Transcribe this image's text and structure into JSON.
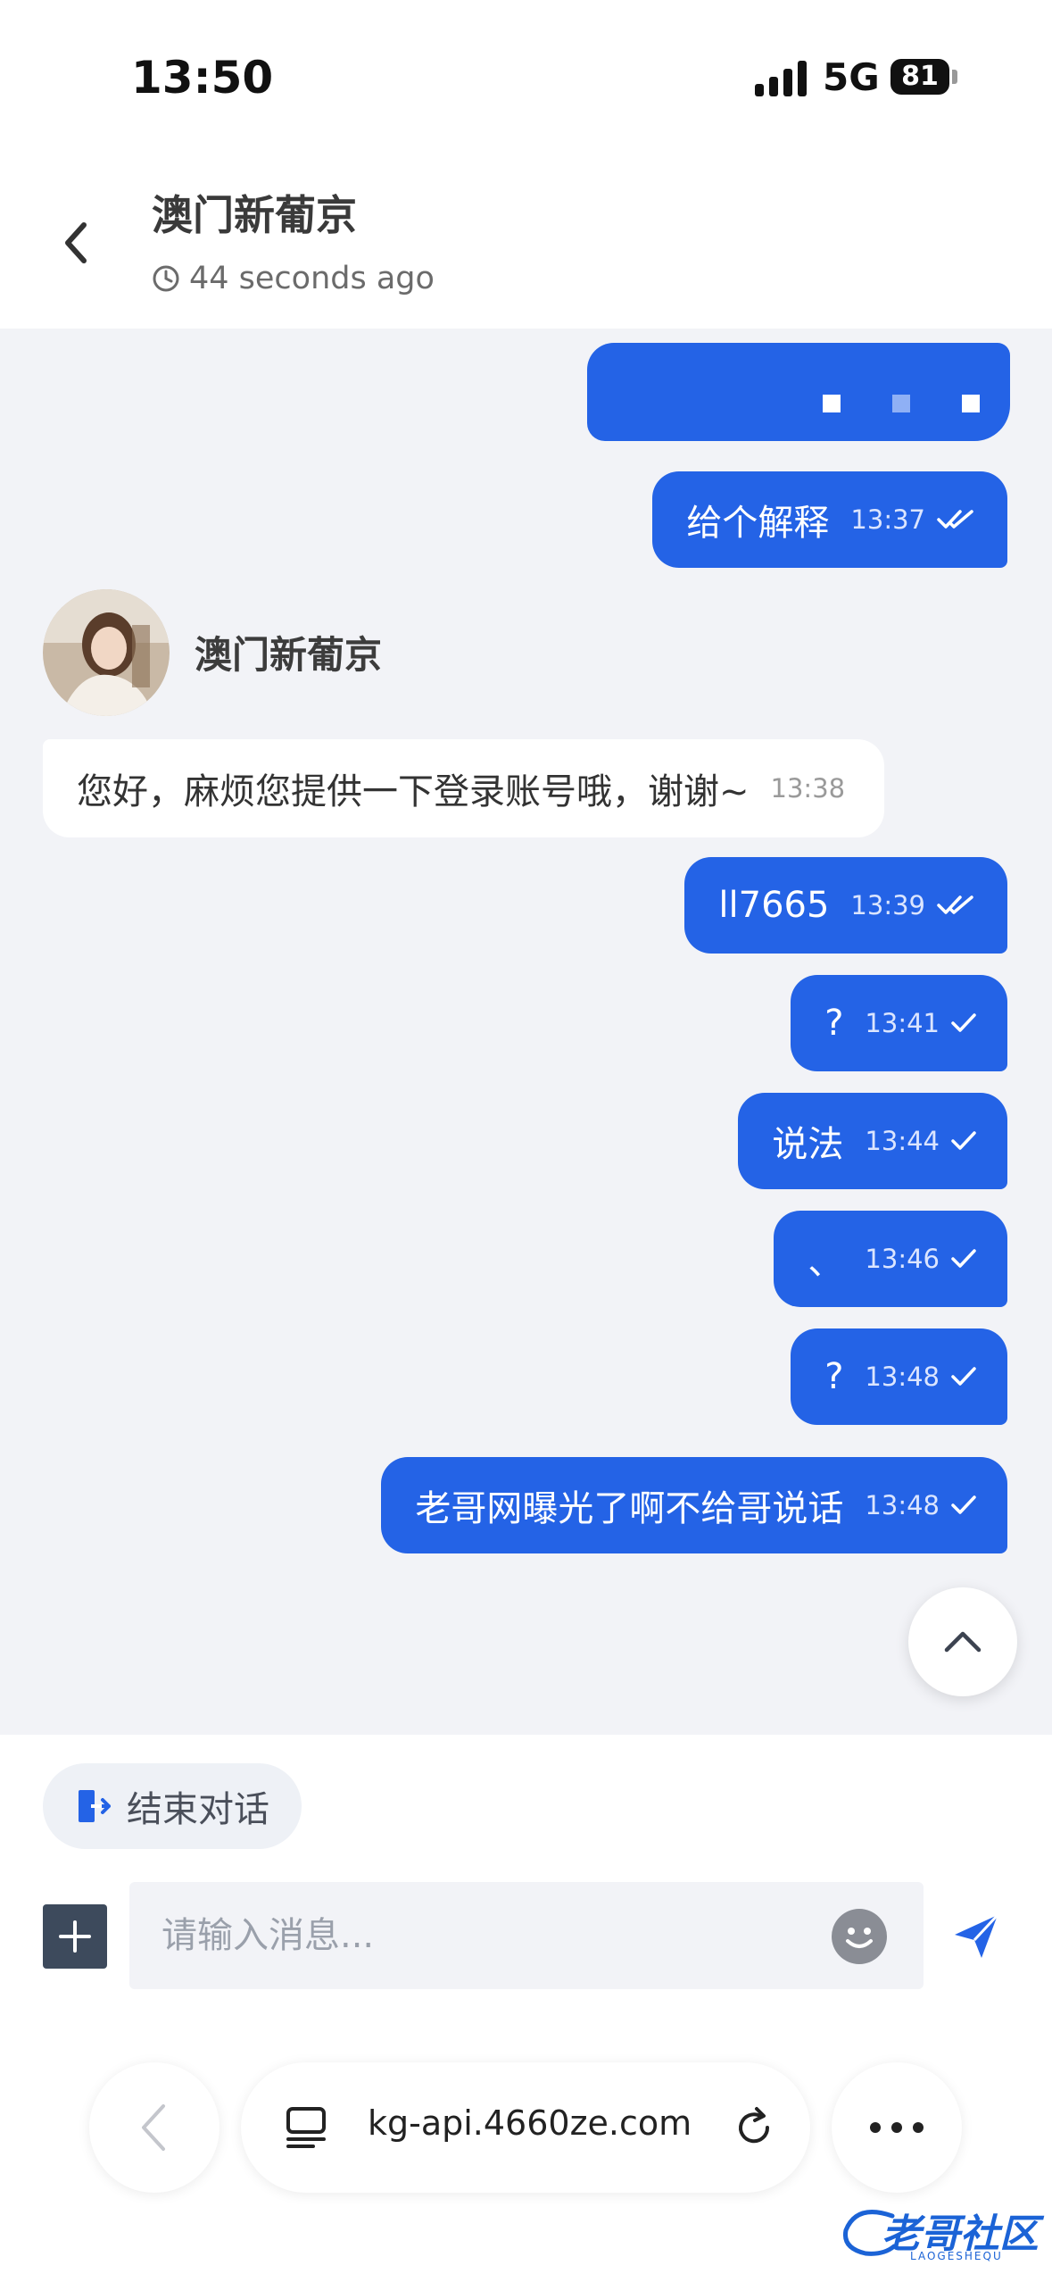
{
  "status_bar": {
    "time": "13:50",
    "network": "5G",
    "battery": "81"
  },
  "header": {
    "title": "澳门新葡京",
    "subtitle": "44 seconds ago"
  },
  "messages": [
    {
      "direction": "out",
      "text": "给个解释",
      "time": "13:37",
      "status": "read"
    },
    {
      "direction": "in",
      "sender": "澳门新葡京",
      "text": "您好，麻烦您提供一下登录账号哦，谢谢~",
      "time": "13:38"
    },
    {
      "direction": "out",
      "text": "ll7665",
      "time": "13:39",
      "status": "read"
    },
    {
      "direction": "out",
      "text": "?",
      "time": "13:41",
      "status": "sent"
    },
    {
      "direction": "out",
      "text": "说法",
      "time": "13:44",
      "status": "sent"
    },
    {
      "direction": "out",
      "text": "、",
      "time": "13:46",
      "status": "sent"
    },
    {
      "direction": "out",
      "text": "?",
      "time": "13:48",
      "status": "sent"
    },
    {
      "direction": "out",
      "text": "老哥网曝光了啊不给哥说话",
      "time": "13:48",
      "status": "sent"
    }
  ],
  "compose": {
    "end_chat_label": "结束对话",
    "input_placeholder": "请输入消息..."
  },
  "browser": {
    "url": "kg-api.4660ze.com"
  },
  "watermark": {
    "text": "老哥社区",
    "subtext": "LAOGESHEQU"
  },
  "colors": {
    "accent": "#2463e6",
    "chat_bg": "#f2f3f7"
  },
  "icons": [
    "back-chevron-icon",
    "clock-icon",
    "double-check-icon",
    "single-check-icon",
    "chevron-up-icon",
    "exit-icon",
    "plus-icon",
    "smiley-icon",
    "send-icon",
    "tabs-icon",
    "reload-icon",
    "more-icon"
  ]
}
